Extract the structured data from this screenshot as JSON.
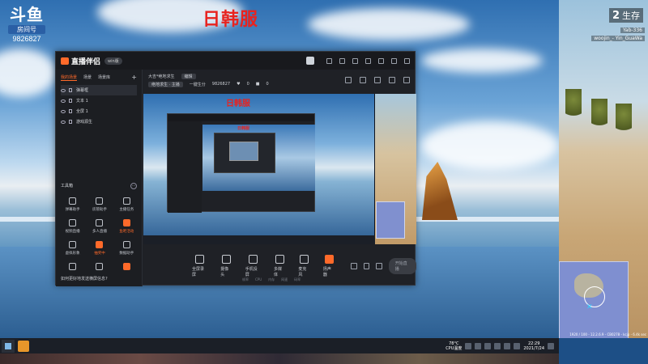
{
  "overlay": {
    "title": "日韩服"
  },
  "douyu": {
    "logo": "斗鱼",
    "room_label": "房间号",
    "room_id": "9826827"
  },
  "game": {
    "survivors_count": "2",
    "survivors_label": "生存",
    "kill_feed": [
      {
        "left": "",
        "right": "Yab-336"
      },
      {
        "left": "woojin_-",
        "right": "Yin_GuaWa"
      }
    ],
    "status": "1920 / 100 - 12.2.6.9 - CB0278 - kcjp - 6.4k sec"
  },
  "app": {
    "name": "直播伴侣",
    "version": "win版",
    "scene_tabs": [
      "我的场景",
      "场景",
      "场景库"
    ],
    "sources": [
      "弹幕框",
      "文本 1",
      "全屏 1",
      "游戏源生"
    ],
    "tools_title": "工具箱",
    "tools": [
      {
        "label": "弹幕助手",
        "hot": false
      },
      {
        "label": "房管助手",
        "hot": false
      },
      {
        "label": "主播任务",
        "hot": false
      },
      {
        "label": "视频直播",
        "hot": false
      },
      {
        "label": "多人直播",
        "hot": false
      },
      {
        "label": "鱼吧活动",
        "hot": true
      },
      {
        "label": "虚拟形象",
        "hot": false
      },
      {
        "label": "抽奖中",
        "hot": true
      },
      {
        "label": "数据助手",
        "hot": false
      },
      {
        "label": "",
        "hot": false
      },
      {
        "label": "",
        "hot": false
      },
      {
        "label": "",
        "hot": true
      }
    ],
    "notice": "如何更好地发送横屏信息?",
    "room": {
      "title": "大吉*绝地求生",
      "title_tag": "编辑",
      "category_tag": "绝地求生 · 主播",
      "line2_a": "一键生分",
      "room_id": "9826827",
      "likes": "0",
      "gifts": "0"
    },
    "controls": [
      "全屏录屏",
      "摄像头",
      "手机投屏",
      "多媒体",
      "麦克风",
      "扬声器"
    ],
    "go_live": "开始直播",
    "status_items": [
      "帧率",
      "CPU",
      "内存",
      "网速",
      "码率"
    ]
  },
  "taskbar": {
    "temperature": "78°C",
    "temp_label": "CPU温度",
    "time": "22:29",
    "date": "2021/7/24"
  }
}
